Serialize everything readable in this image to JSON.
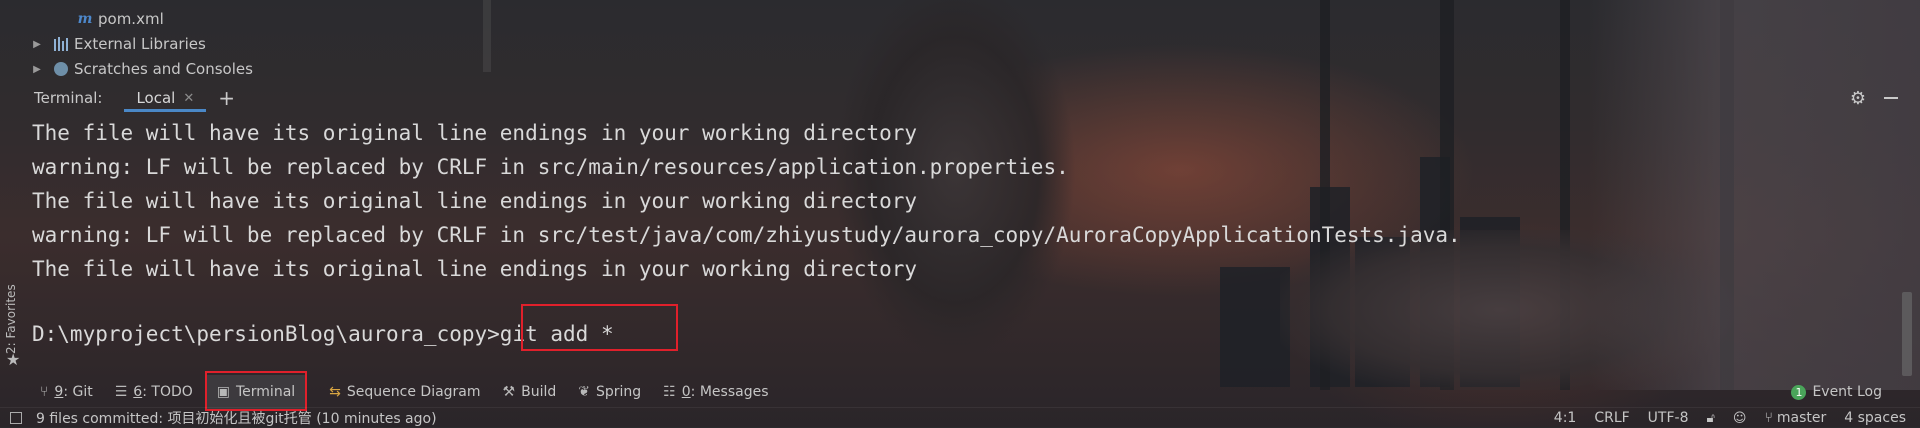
{
  "project_tree": {
    "items": [
      {
        "label": "pom.xml",
        "icon": "maven-file-icon",
        "expandable": false
      },
      {
        "label": "External Libraries",
        "icon": "library-icon",
        "expandable": true
      },
      {
        "label": "Scratches and Consoles",
        "icon": "scratches-icon",
        "expandable": true
      }
    ]
  },
  "terminal": {
    "title": "Terminal:",
    "tab_label": "Local",
    "lines": [
      "The file will have its original line endings in your working directory",
      "warning: LF will be replaced by CRLF in src/main/resources/application.properties.",
      "The file will have its original line endings in your working directory",
      "warning: LF will be replaced by CRLF in src/test/java/com/zhiyustudy/aurora_copy/AuroraCopyApplicationTests.java.",
      "The file will have its original line endings in your working directory"
    ],
    "prompt_path": "D:\\myproject\\persionBlog\\aurora_copy>",
    "command": "git add *"
  },
  "favorites": {
    "label": "2: Favorites"
  },
  "tool_windows": [
    {
      "num": "9",
      "label": "Git",
      "icon": "git-branch-icon"
    },
    {
      "num": "6",
      "label": "TODO",
      "icon": "todo-list-icon"
    },
    {
      "num": "",
      "label": "Terminal",
      "icon": "terminal-icon"
    },
    {
      "num": "",
      "label": "Sequence Diagram",
      "icon": "sequence-diagram-icon"
    },
    {
      "num": "",
      "label": "Build",
      "icon": "hammer-icon"
    },
    {
      "num": "",
      "label": "Spring",
      "icon": "spring-leaf-icon"
    },
    {
      "num": "0",
      "label": "Messages",
      "icon": "messages-icon"
    }
  ],
  "event_log": {
    "label": "Event Log",
    "count": "1"
  },
  "status_bar": {
    "message": "9 files committed: 项目初始化且被git托管 (10 minutes ago)",
    "position": "4:1",
    "line_separator": "CRLF",
    "encoding": "UTF-8",
    "branch": "master",
    "indent": "4 spaces"
  },
  "colors": {
    "highlight_box": "#e0202b",
    "tab_underline": "#4a88c7"
  }
}
